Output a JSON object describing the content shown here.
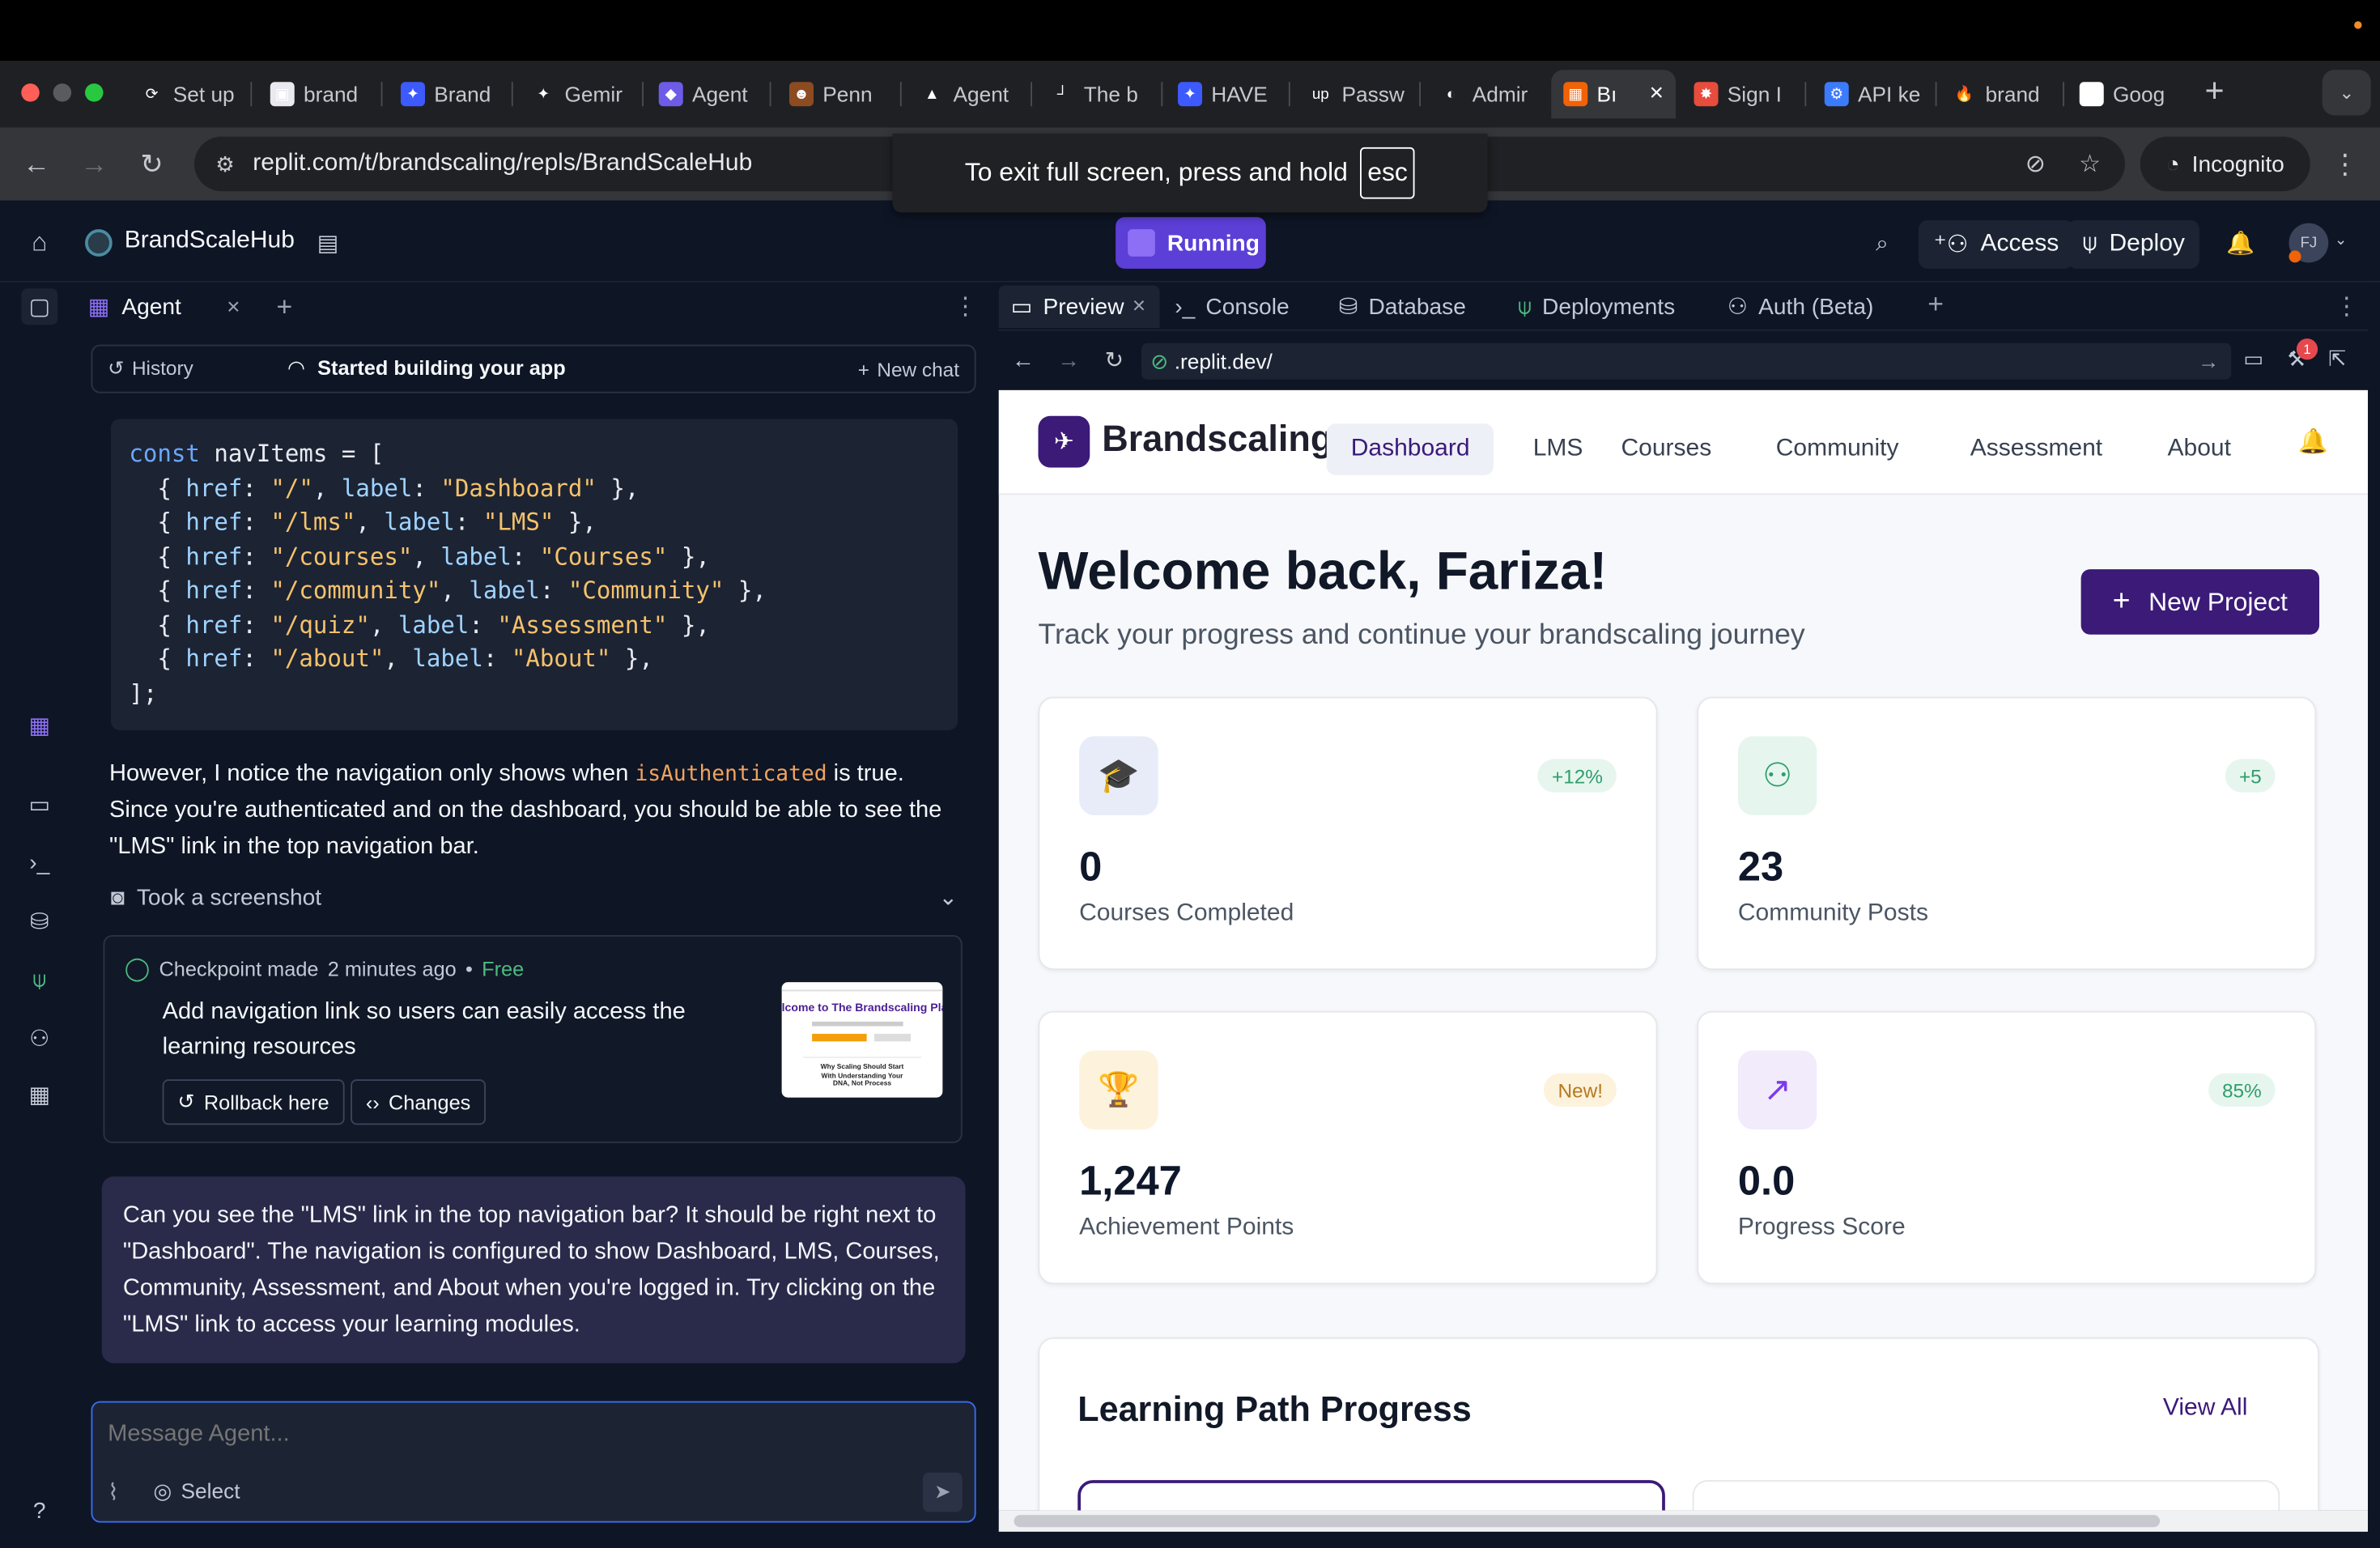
{
  "browser": {
    "tabs": [
      {
        "label": "Set up",
        "fav": "⟳",
        "color": "#1f2023"
      },
      {
        "label": "brand",
        "fav": "▣",
        "color": "#e9e9ef"
      },
      {
        "label": "Brand",
        "fav": "✦",
        "color": "#3d5afe"
      },
      {
        "label": "Gemir",
        "fav": "✦",
        "color": "#1f2023"
      },
      {
        "label": "Agent",
        "fav": "◆",
        "color": "#6c5ce7"
      },
      {
        "label": "Penn",
        "fav": "☻",
        "color": "#8d4b22"
      },
      {
        "label": "Agent",
        "fav": "▲",
        "color": "#1f2023"
      },
      {
        "label": "The b",
        "fav": "┘",
        "color": "#1f2023"
      },
      {
        "label": "HAVE",
        "fav": "✦",
        "color": "#3d5afe"
      },
      {
        "label": "Passw",
        "fav": "up",
        "color": "#1f2023"
      },
      {
        "label": "Admir",
        "fav": "◐",
        "color": "#1f2023"
      },
      {
        "label": "Bı",
        "fav": "▦",
        "color": "#f26207"
      },
      {
        "label": "Sign I",
        "fav": "✸",
        "color": "#e74c3c"
      },
      {
        "label": "API ke",
        "fav": "⚙",
        "color": "#3d7bfd"
      },
      {
        "label": "brand",
        "fav": "🔥",
        "color": "#1f2023"
      },
      {
        "label": "Goog",
        "fav": "G",
        "color": "#fff"
      }
    ],
    "url": "replit.com/t/brandscaling/repls/BrandScaleHub",
    "incognito_label": "Incognito",
    "fullscreen_msg": "To exit full screen, press and hold",
    "esc_key": "esc"
  },
  "replit": {
    "project_name": "BrandScaleHub",
    "running_label": "Running",
    "access_label": "Access",
    "deploy_label": "Deploy",
    "avatar_initials": "FJ"
  },
  "agent": {
    "tab_label": "Agent",
    "history_label": "History",
    "status_label": "Started building your app",
    "new_chat_label": "New chat",
    "code_lines": [
      "const navItems = [",
      "  { href: \"/\", label: \"Dashboard\" },",
      "  { href: \"/lms\", label: \"LMS\" },",
      "  { href: \"/courses\", label: \"Courses\" },",
      "  { href: \"/community\", label: \"Community\" },",
      "  { href: \"/quiz\", label: \"Assessment\" },",
      "  { href: \"/about\", label: \"About\" },",
      "];"
    ],
    "para_before": "However, I notice the navigation only shows when",
    "para_code": "isAuthenticated",
    "para_after": "is true. Since you're authenticated and on the dashboard, you should be able to see the \"LMS\" link in the top navigation bar.",
    "screenshot_label": "Took a screenshot",
    "checkpoint_title": "Checkpoint made",
    "checkpoint_time": "2 minutes ago",
    "checkpoint_free": "Free",
    "checkpoint_desc": "Add navigation link so users can easily access the learning resources",
    "rollback_label": "Rollback here",
    "changes_label": "Changes",
    "thumb_heading": "lcome to The Brandscaling Platfo",
    "thumb_sub": "Why Scaling Should Start With Understanding Your DNA, Not Process",
    "user_message": "Can you see the \"LMS\" link in the top navigation bar? It should be right next to \"Dashboard\". The navigation is configured to show Dashboard, LMS, Courses, Community, Assessment, and About when you're logged in. Try clicking on the \"LMS\" link to access your learning modules.",
    "input_placeholder": "Message Agent...",
    "select_label": "Select"
  },
  "preview": {
    "tabs": [
      {
        "label": "Preview",
        "icon": "monitor-icon"
      },
      {
        "label": "Console",
        "icon": "terminal-icon"
      },
      {
        "label": "Database",
        "icon": "database-icon"
      },
      {
        "label": "Deployments",
        "icon": "deploy-icon"
      },
      {
        "label": "Auth (Beta)",
        "icon": "auth-icon"
      }
    ],
    "url": ".replit.dev/",
    "notif_count": "1"
  },
  "app": {
    "brand": "Brandscaling",
    "nav": [
      "Dashboard",
      "LMS",
      "Courses",
      "Community",
      "Assessment",
      "About"
    ],
    "active_nav": "Dashboard",
    "welcome": "Welcome back, Fariza!",
    "subtitle": "Track your progress and continue your brandscaling journey",
    "new_project": "New Project",
    "stats": [
      {
        "value": "0",
        "label": "Courses Completed",
        "badge": "+12%",
        "icon": "graduation-cap-icon"
      },
      {
        "value": "23",
        "label": "Community Posts",
        "badge": "+5",
        "icon": "users-icon"
      },
      {
        "value": "1,247",
        "label": "Achievement Points",
        "badge": "New!",
        "icon": "trophy-icon"
      },
      {
        "value": "0.0",
        "label": "Progress Score",
        "badge": "85%",
        "icon": "trending-up-icon"
      }
    ],
    "learning_title": "Learning Path Progress",
    "view_all": "View All"
  },
  "colors": {
    "accent": "#3b1a78",
    "replit_purple": "#5b3fd6",
    "app_bg": "#f7f8fb"
  }
}
